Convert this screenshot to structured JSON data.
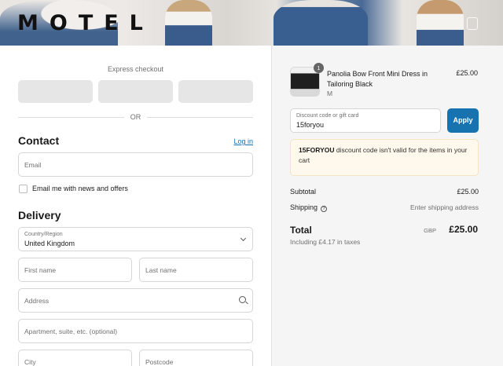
{
  "header": {
    "logo": "MOTEL"
  },
  "express": {
    "label": "Express checkout",
    "or": "OR"
  },
  "contact": {
    "title": "Contact",
    "login": "Log in",
    "email_placeholder": "Email",
    "newsletter_label": "Email me with news and offers"
  },
  "delivery": {
    "title": "Delivery",
    "country_label": "Country/Region",
    "country_value": "United Kingdom",
    "first_name": "First name",
    "last_name": "Last name",
    "address": "Address",
    "apartment": "Apartment, suite, etc. (optional)",
    "city": "City",
    "postcode": "Postcode"
  },
  "order": {
    "quantity": "1",
    "product_name": "Panolia Bow Front Mini Dress in Tailoring Black",
    "variant": "M",
    "price": "£25.00",
    "discount_label": "Discount code or gift card",
    "discount_value": "15foryou",
    "apply": "Apply",
    "alert_code": "15FORYOU",
    "alert_text": " discount code isn't valid for the items in your cart",
    "subtotal_label": "Subtotal",
    "subtotal_value": "£25.00",
    "shipping_label": "Shipping",
    "shipping_value": "Enter shipping address",
    "total_label": "Total",
    "currency": "GBP",
    "total_value": "£25.00",
    "taxes": "Including £4.17 in taxes"
  },
  "colors": {
    "accent": "#1773b0",
    "alert_bg": "#fff8ec"
  }
}
